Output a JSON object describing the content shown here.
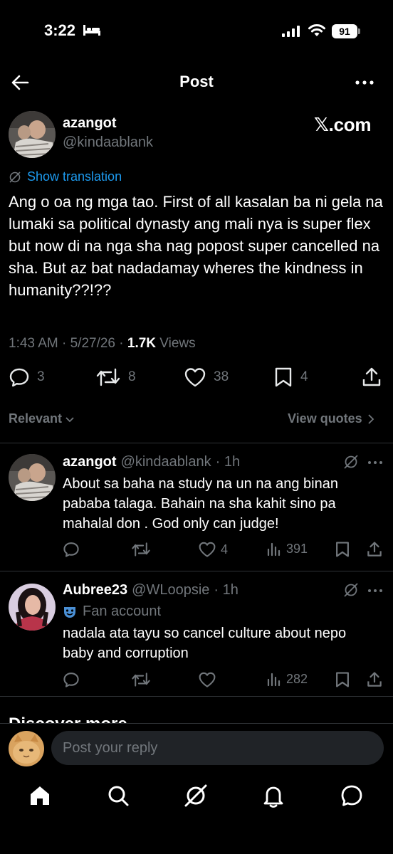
{
  "status_bar": {
    "time": "3:22",
    "battery": "91"
  },
  "header": {
    "title": "Post"
  },
  "post": {
    "author_name": "azangot",
    "author_handle": "@kindaablank",
    "watermark": "𝕏.com",
    "translation_label": "Show translation",
    "body": "Ang o oa ng mga tao. First of all kasalan ba ni gela na lumaki sa political dynasty ang mali nya is super flex but now di na nga sha nag popost super cancelled na sha. But az bat nadadamay wheres the kindness in humanity??!??",
    "time": "1:43 AM · 5/27/26 · ",
    "views_count": "1.7K",
    "views_label": " Views",
    "replies": "3",
    "reposts": "8",
    "likes": "38",
    "bookmarks": "4"
  },
  "sort": {
    "label": "Relevant",
    "view_quotes": "View quotes"
  },
  "replies": [
    {
      "name": "azangot",
      "handle": "@kindaablank",
      "time": "· 1h",
      "text": "About sa baha  na study na un na ang binan pababa talaga. Bahain na sha kahit sino pa mahalal don . God only can judge!",
      "likes": "4",
      "views": "391"
    },
    {
      "name": "Aubree23",
      "handle": "@WLoopsie",
      "time": "· 1h",
      "badge": "Fan account",
      "text": "nadala ata tayu so cancel culture about nepo baby and corruption",
      "likes": "",
      "views": "282"
    }
  ],
  "discover": "Discover more",
  "composer": {
    "placeholder": "Post your reply"
  },
  "colors": {
    "accent": "#1d9bf0",
    "muted": "#71767b",
    "background": "#000000",
    "input": "#202327"
  }
}
